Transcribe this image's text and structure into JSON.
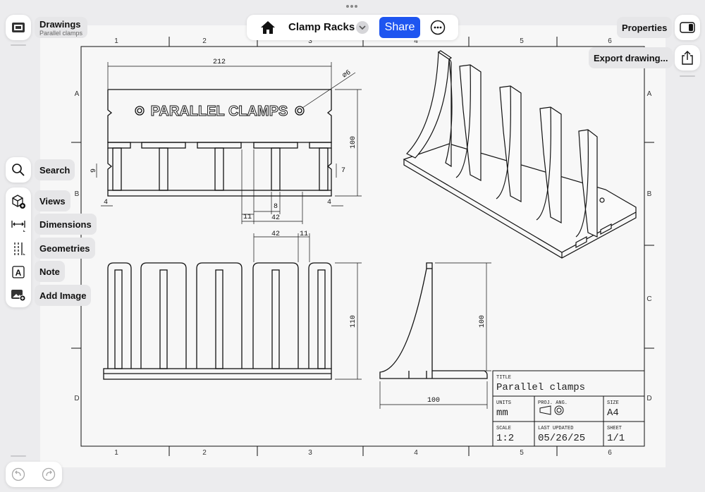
{
  "document": {
    "title": "Clamp Racks",
    "share_label": "Share"
  },
  "drawings": {
    "label": "Drawings",
    "subtitle": "Parallel clamps"
  },
  "tools": {
    "search": "Search",
    "views": "Views",
    "dimensions": "Dimensions",
    "geometries": "Geometries",
    "note": "Note",
    "add_image": "Add Image"
  },
  "right_panel": {
    "properties": "Properties",
    "export": "Export drawing..."
  },
  "sheet": {
    "columns": [
      "1",
      "2",
      "3",
      "4",
      "5",
      "6"
    ],
    "rows": [
      "A",
      "B",
      "C",
      "D"
    ],
    "front_label": "PARALLEL CLAMPS"
  },
  "dimensions": {
    "width_total": "212",
    "hole_dia": "⌀6",
    "height_front": "100",
    "left_slot": "9",
    "right_slot": "7",
    "edge_left": "4",
    "edge_right": "4",
    "gap_a": "11",
    "gap_b": "8",
    "pitch": "42",
    "top_pitch": "42",
    "top_gap": "11",
    "height_top": "110",
    "side_height": "100",
    "side_width": "100"
  },
  "title_block": {
    "title_label": "TITLE",
    "title_value": "Parallel clamps",
    "units_label": "UNITS",
    "units_value": "mm",
    "proj_label": "PROJ. ANG.",
    "size_label": "SIZE",
    "size_value": "A4",
    "scale_label": "SCALE",
    "scale_value": "1:2",
    "updated_label": "LAST UPDATED",
    "updated_value": "05/26/25",
    "sheet_label": "SHEET",
    "sheet_value": "1/1"
  },
  "colors": {
    "accent": "#1e55f0",
    "line": "#111111",
    "sheet": "#f7f7f7",
    "background": "#ececee"
  }
}
